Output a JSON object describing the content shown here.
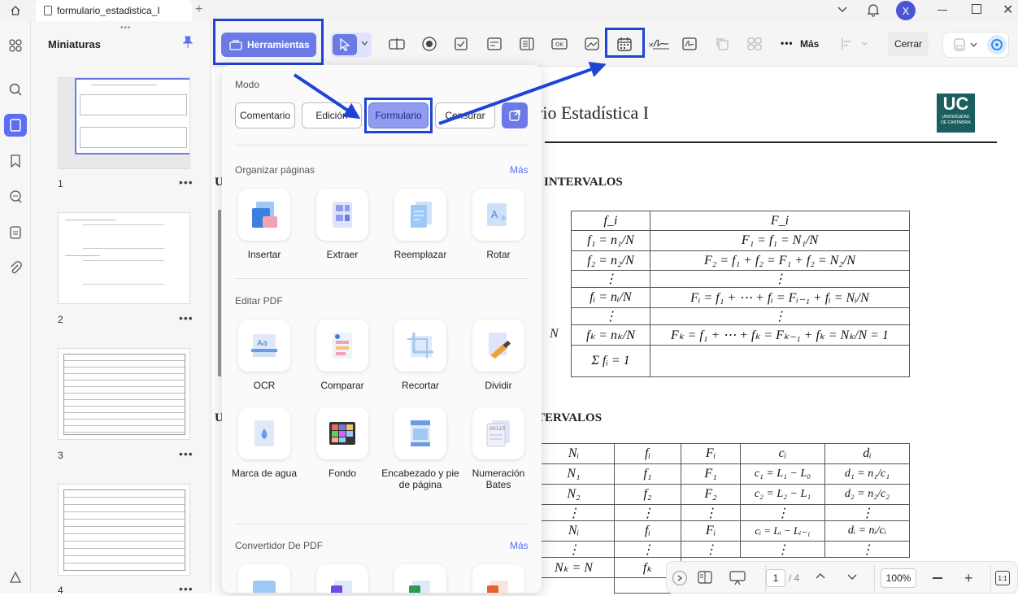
{
  "tab": {
    "title": "formulario_estadistica_I"
  },
  "user": {
    "initial": "X"
  },
  "sidebar": {
    "title": "Miniaturas",
    "pages": [
      "1",
      "2",
      "3",
      "4"
    ]
  },
  "toolbar": {
    "herramientas": "Herramientas",
    "mas": "Más",
    "cerrar": "Cerrar"
  },
  "menu": {
    "modo_label": "Modo",
    "modes": [
      "Comentario",
      "Edición",
      "Formulario",
      "Censurar"
    ],
    "organizar_title": "Organizar páginas",
    "organizar_more": "Más",
    "organizar_tools": [
      "Insertar",
      "Extraer",
      "Reemplazar",
      "Rotar"
    ],
    "editar_title": "Editar PDF",
    "editar_tools": [
      "OCR",
      "Comparar",
      "Recortar",
      "Dividir",
      "Marca de agua",
      "Fondo",
      "Encabezado y pie de página",
      "Numeración Bates"
    ],
    "convertidor_title": "Convertidor De PDF",
    "convertidor_more": "Más"
  },
  "document": {
    "title_visible": "rio Estadística I",
    "logo_text": "UC",
    "logo_sub1": "UNIVERSIDAD",
    "logo_sub2": "DE CANTABRIA",
    "heading1_left": "U",
    "heading1": "INTERVALOS",
    "heading2_left": "U",
    "heading2": "TERVALOS",
    "table1": {
      "headers": [
        "f_i",
        "F_i"
      ],
      "rows": [
        [
          "f₁ = n₁/N",
          "F₁ = f₁ = N₁/N"
        ],
        [
          "f₂ = n₂/N",
          "F₂ = f₁ + f₂ = F₁ + f₂ = N₂/N"
        ],
        [
          "⋮",
          "⋮"
        ],
        [
          "fᵢ = nᵢ/N",
          "Fᵢ = f₁ + ⋯ + fᵢ = Fᵢ₋₁ + fᵢ = Nᵢ/N"
        ],
        [
          "⋮",
          "⋮"
        ],
        [
          "fₖ = nₖ/N",
          "Fₖ = f₁ + ⋯ + fₖ = Fₖ₋₁ + fₖ = Nₖ/N = 1"
        ],
        [
          "Σ fᵢ = 1",
          ""
        ]
      ],
      "left_fragments": [
        "i",
        "N"
      ]
    },
    "table2": {
      "headers": [
        "Nᵢ",
        "fᵢ",
        "Fᵢ",
        "cᵢ",
        "dᵢ"
      ],
      "rows": [
        [
          "N₁",
          "f₁",
          "F₁",
          "c₁ = L₁ − L₀",
          "d₁ = n₁/c₁"
        ],
        [
          "N₂",
          "f₂",
          "F₂",
          "c₂ = L₂ − L₁",
          "d₂ = n₂/c₂"
        ],
        [
          "⋮",
          "⋮",
          "⋮",
          "⋮",
          "⋮"
        ],
        [
          "Nᵢ",
          "fᵢ",
          "Fᵢ",
          "cᵢ = Lᵢ − Lᵢ₋₁",
          "dᵢ = nᵢ/cᵢ"
        ],
        [
          "⋮",
          "⋮",
          "⋮",
          "⋮",
          "⋮"
        ],
        [
          "Nₖ = N",
          "fₖ",
          "",
          "",
          ""
        ]
      ]
    }
  },
  "bottombar": {
    "page_current": "1",
    "page_total": "/ 4",
    "zoom": "100%"
  },
  "colors": {
    "accent": "#5b6ef5",
    "highlight": "#1f44d6",
    "logo": "#1a5e5e"
  }
}
